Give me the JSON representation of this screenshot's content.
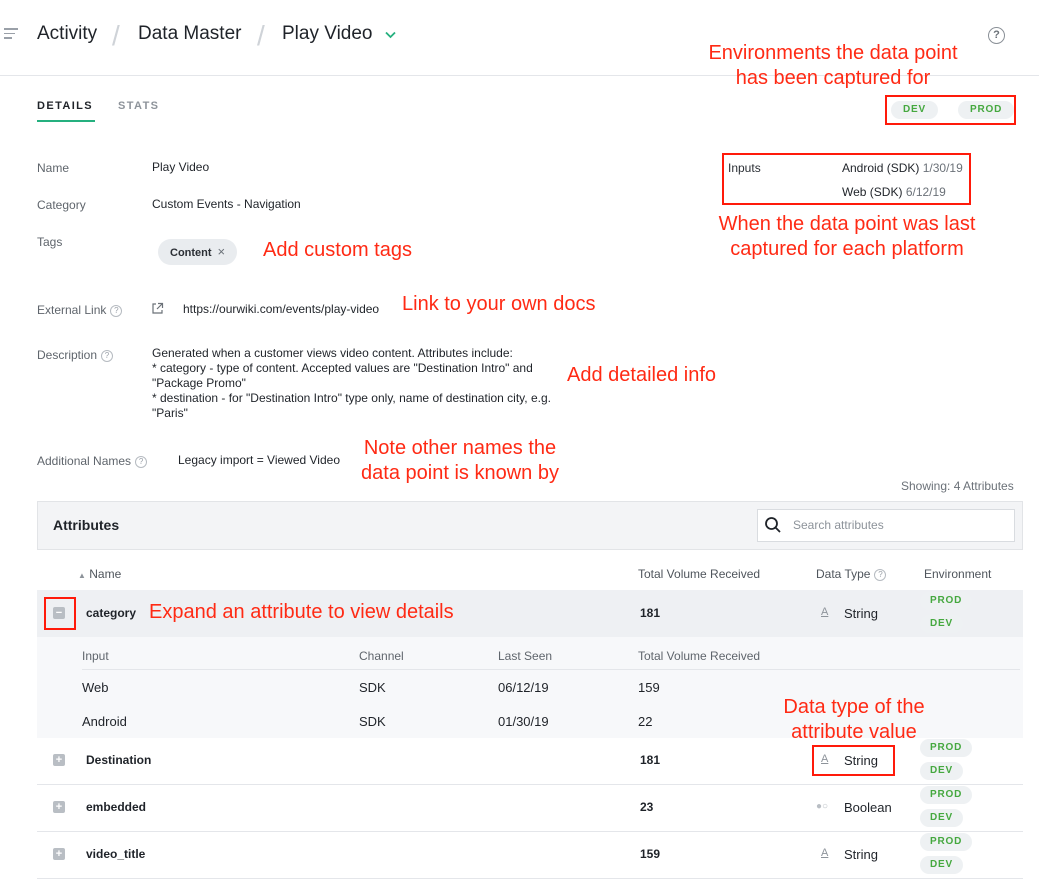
{
  "header": {
    "breadcrumb": [
      "Activity",
      "Data Master",
      "Play Video"
    ],
    "help_label": "?"
  },
  "tabs": [
    "DETAILS",
    "STATS"
  ],
  "environments": [
    "DEV",
    "PROD"
  ],
  "details": {
    "name_label": "Name",
    "name_value": "Play Video",
    "category_label": "Category",
    "category_value": "Custom Events - Navigation",
    "tags_label": "Tags",
    "tag": "Content",
    "tag_close": "×",
    "external_link_label": "External Link",
    "external_link_value": "https://ourwiki.com/events/play-video",
    "description_label": "Description",
    "description_lines": [
      "Generated when a customer views video content. Attributes include:",
      "* category - type of content. Accepted values are \"Destination Intro\" and",
      "\"Package Promo\"",
      "* destination - for \"Destination Intro\" type only, name of destination city, e.g.",
      "\"Paris\""
    ],
    "additional_names_label": "Additional Names",
    "additional_names_value": "Legacy import = Viewed Video"
  },
  "inputs": {
    "label": "Inputs",
    "rows": [
      {
        "source": "Android (SDK)",
        "date": "1/30/19"
      },
      {
        "source": "Web (SDK)",
        "date": "6/12/19"
      }
    ]
  },
  "annotations": {
    "envs": [
      "Environments the data point",
      "has been captured for"
    ],
    "last_captured": [
      "When the data point was last",
      "captured for each platform"
    ],
    "tags": "Add custom tags",
    "docs": "Link to your own docs",
    "detailed": "Add detailed info",
    "other_names": [
      "Note other names the",
      "data point is known by"
    ],
    "expand": "Expand an attribute to view details",
    "data_type": [
      "Data type of the",
      "attribute value"
    ]
  },
  "attributes": {
    "showing": "Showing: 4 Attributes",
    "title": "Attributes",
    "search_placeholder": "Search attributes",
    "columns": [
      "Name",
      "Total Volume Received",
      "Data Type",
      "Environment"
    ],
    "sort_glyph": "▲",
    "rows": [
      {
        "name": "category",
        "volume": "181",
        "type": "String",
        "type_icon": "string-icon",
        "expanded": true,
        "envs": [
          "PROD",
          "DEV"
        ]
      },
      {
        "name": "Destination",
        "volume": "181",
        "type": "String",
        "type_icon": "string-icon",
        "expanded": false,
        "envs": [
          "PROD",
          "DEV"
        ]
      },
      {
        "name": "embedded",
        "volume": "23",
        "type": "Boolean",
        "type_icon": "boolean-icon",
        "expanded": false,
        "envs": [
          "PROD",
          "DEV"
        ]
      },
      {
        "name": "video_title",
        "volume": "159",
        "type": "String",
        "type_icon": "string-icon",
        "expanded": false,
        "envs": [
          "PROD",
          "DEV"
        ]
      }
    ],
    "sub_columns": [
      "Input",
      "Channel",
      "Last Seen",
      "Total Volume Received"
    ],
    "sub_rows": [
      {
        "input": "Web",
        "channel": "SDK",
        "last_seen": "06/12/19",
        "volume": "159"
      },
      {
        "input": "Android",
        "channel": "SDK",
        "last_seen": "01/30/19",
        "volume": "22"
      }
    ],
    "expand_glyph": "+",
    "collapse_glyph": "−",
    "string_glyph": "A",
    "boolean_glyph": "●○"
  },
  "colors": {
    "accent": "#25b07f",
    "env_text": "#45a83f",
    "annotation": "#ff2a14"
  }
}
